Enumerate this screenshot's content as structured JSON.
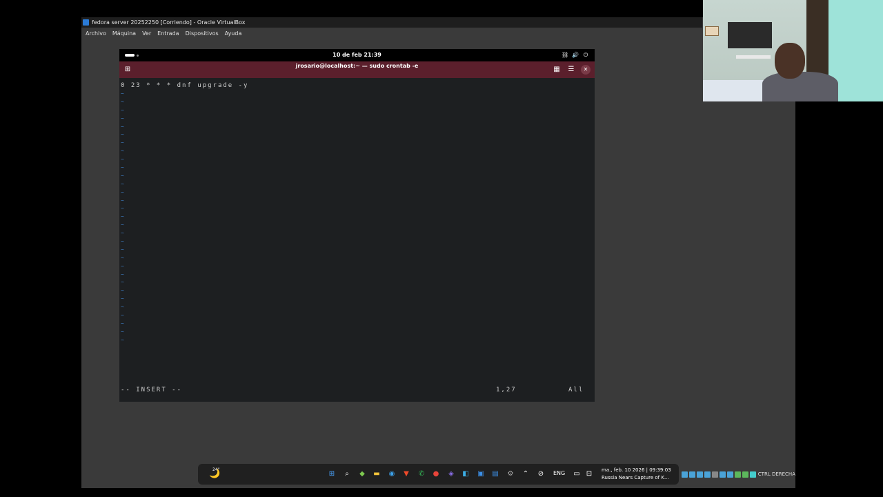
{
  "vbox": {
    "title": "fedora server 20252250 [Corriendo] - Oracle VirtualBox",
    "menu": [
      "Archivo",
      "Máquina",
      "Ver",
      "Entrada",
      "Dispositivos",
      "Ayuda"
    ],
    "host_key_label": "CTRL DERECHA"
  },
  "gnome": {
    "clock": "10 de feb  21:39",
    "tray_icons": [
      "network-icon",
      "volume-icon",
      "power-icon"
    ]
  },
  "terminal": {
    "title": "jrosario@localhost:~ — sudo crontab -e",
    "line1": "0 23 * * * dnf upgrade -y",
    "tilde": "~",
    "mode": "-- INSERT --",
    "position": "1,27",
    "scroll": "All"
  },
  "taskbar": {
    "weather_temp": "24°",
    "language": "ENG",
    "date_line": "ma., feb. 10 2026 | 09:39:03",
    "news_line": "Russia Nears Capture of K...",
    "accent": "#0078d4"
  },
  "colors": {
    "terminal_header": "#5b1f2c",
    "terminal_bg": "#1d1f21",
    "vim_tilde": "#3f7fc7"
  }
}
